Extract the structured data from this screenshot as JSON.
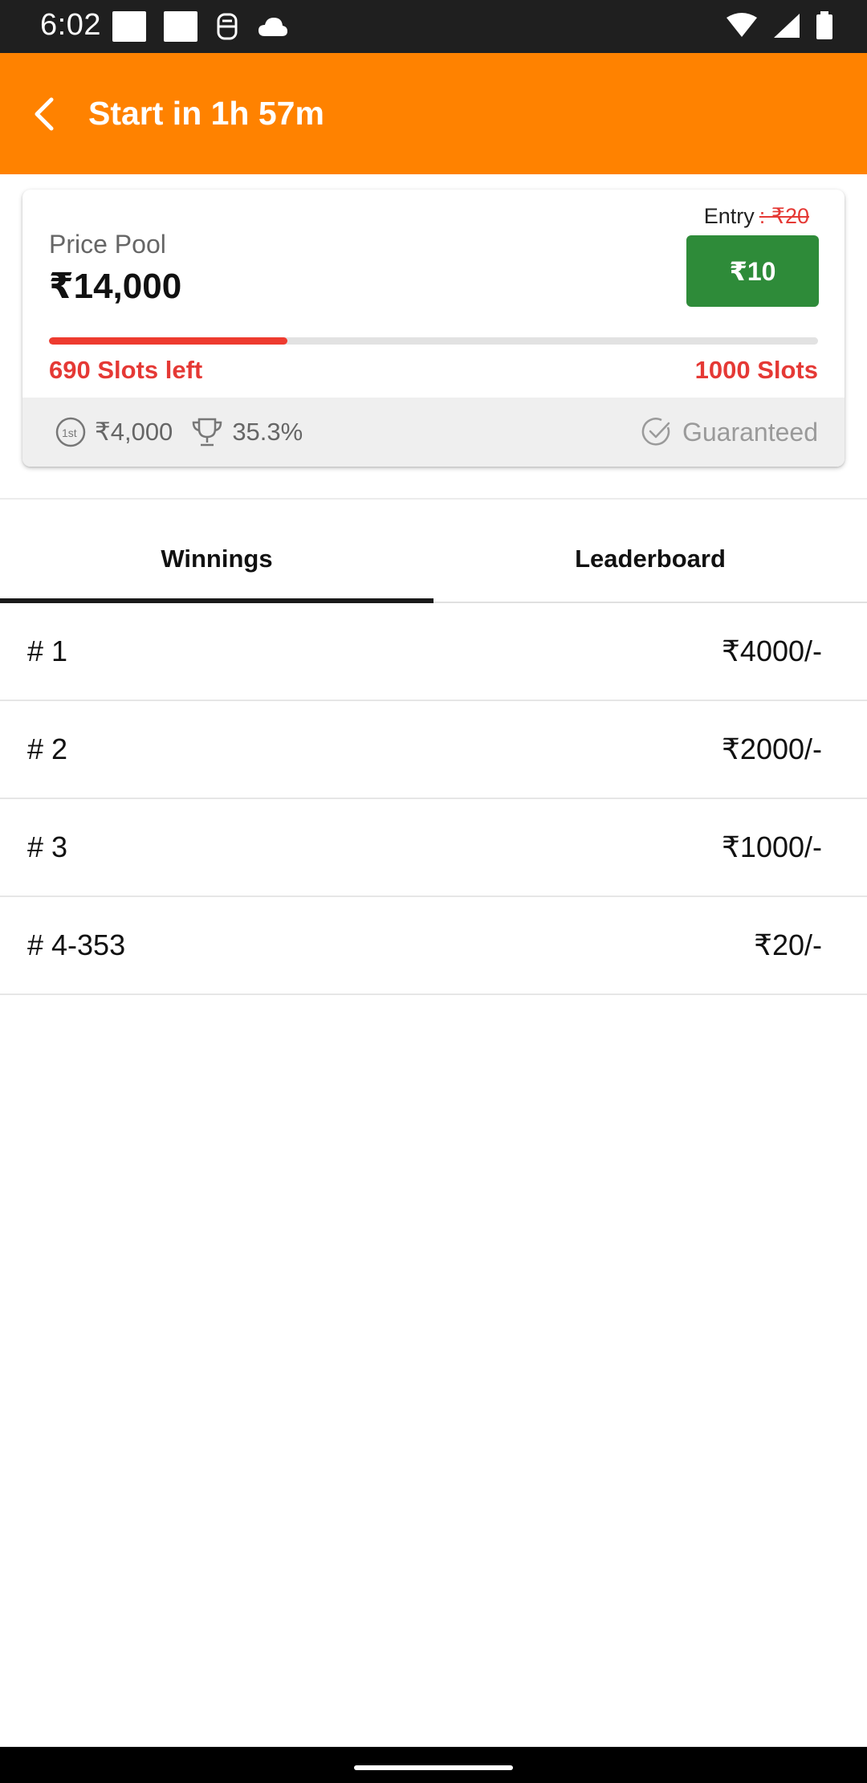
{
  "status_bar": {
    "time": "6:02"
  },
  "app_bar": {
    "title": "Start in 1h 57m"
  },
  "contest_card": {
    "pool_label": "Price Pool",
    "pool_value": "₹14,000",
    "entry_label": "Entry",
    "entry_original": ": ₹20",
    "entry_button": "₹10",
    "slots_left": "690 Slots left",
    "slots_total": "1000 Slots",
    "progress_fraction": 0.31,
    "first_prize": "₹4,000",
    "win_percent": "35.3%",
    "guaranteed_label": "Guaranteed",
    "colors": {
      "accent": "#ff8200",
      "join": "#2e8b39",
      "alert": "#e53935"
    }
  },
  "tabs": [
    {
      "label": "Winnings",
      "active": true
    },
    {
      "label": "Leaderboard",
      "active": false
    }
  ],
  "winnings": [
    {
      "rank": "# 1",
      "amount": "₹4000/-"
    },
    {
      "rank": "# 2",
      "amount": "₹2000/-"
    },
    {
      "rank": "# 3",
      "amount": "₹1000/-"
    },
    {
      "rank": "# 4-353",
      "amount": "₹20/-"
    }
  ]
}
